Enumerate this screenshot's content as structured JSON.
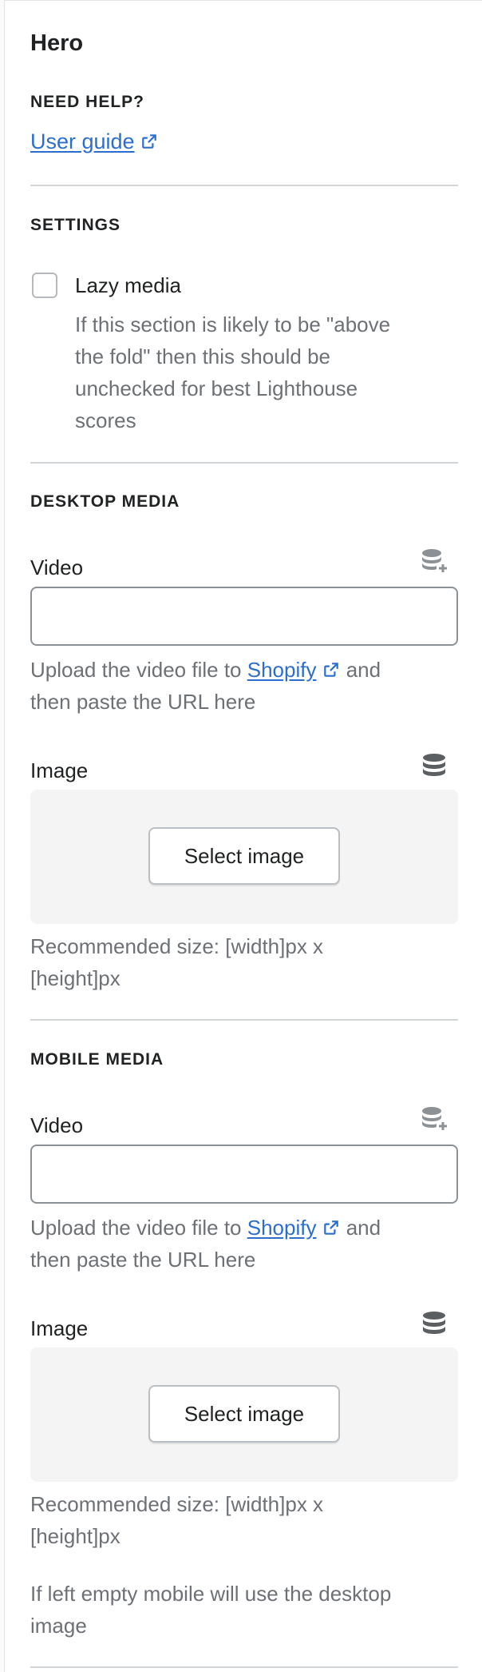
{
  "panel": {
    "title": "Hero",
    "help": {
      "heading": "NEED HELP?",
      "link_label": "User guide"
    },
    "settings": {
      "heading": "SETTINGS",
      "lazy_media": {
        "label": "Lazy media",
        "checked": false,
        "help_lines": [
          "If this section is likely to be \"above",
          "the fold\" then this should be",
          "unchecked for best Lighthouse",
          "scores"
        ]
      }
    },
    "desktop_media": {
      "heading": "DESKTOP MEDIA",
      "video": {
        "label": "Video",
        "value": "",
        "help_prefix": "Upload the video file to ",
        "help_link": "Shopify",
        "help_suffix": " and",
        "help_line2": "then paste the URL here"
      },
      "image": {
        "label": "Image",
        "button_label": "Select image",
        "help_line1": "Recommended size: [width]px x",
        "help_line2": "[height]px"
      }
    },
    "mobile_media": {
      "heading": "MOBILE MEDIA",
      "video": {
        "label": "Video",
        "value": "",
        "help_prefix": "Upload the video file to ",
        "help_link": "Shopify",
        "help_suffix": " and",
        "help_line2": "then paste the URL here"
      },
      "image": {
        "label": "Image",
        "button_label": "Select image",
        "help_line1": "Recommended size: [width]px x",
        "help_line2": "[height]px",
        "note_line1": "If left empty mobile will use the desktop",
        "note_line2": "image"
      }
    }
  },
  "icons": {
    "external_link": "external-link-icon",
    "dynamic_source": "dynamic-source-icon",
    "dynamic_source_add": "dynamic-source-add-icon"
  },
  "colors": {
    "link": "#2c6ecb",
    "muted_text": "#6d7175",
    "divider": "#d2d5d8",
    "image_box_bg": "#f4f4f4"
  }
}
